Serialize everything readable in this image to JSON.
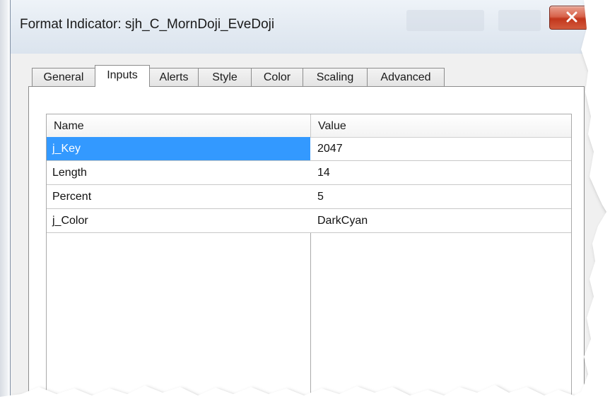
{
  "window": {
    "title": "Format Indicator: sjh_C_MornDoji_EveDoji",
    "close_icon": "close-x-icon",
    "close_color": "#c7402a"
  },
  "tabs": [
    {
      "label": "General"
    },
    {
      "label": "Inputs",
      "active": true
    },
    {
      "label": "Alerts"
    },
    {
      "label": "Style"
    },
    {
      "label": "Color"
    },
    {
      "label": "Scaling"
    },
    {
      "label": "Advanced"
    }
  ],
  "inputs_grid": {
    "columns": [
      "Name",
      "Value"
    ],
    "rows": [
      {
        "name": "j_Key",
        "value": "2047",
        "selected": true
      },
      {
        "name": "Length",
        "value": "14"
      },
      {
        "name": "Percent",
        "value": "5"
      },
      {
        "name": "j_Color",
        "value": "DarkCyan"
      }
    ],
    "selection_color": "#3399ff"
  }
}
